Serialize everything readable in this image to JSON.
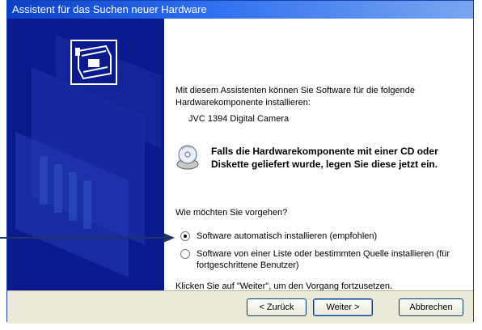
{
  "window": {
    "title": "Assistent für das Suchen neuer Hardware"
  },
  "content": {
    "intro": "Mit diesem Assistenten können Sie Software für die folgende Hardwarekomponente installieren:",
    "device_name": "JVC 1394 Digital Camera",
    "cd_hint": "Falls die Hardwarekomponente mit einer CD oder Diskette geliefert wurde, legen Sie diese jetzt ein.",
    "question": "Wie möchten Sie vorgehen?",
    "options": [
      {
        "label": "Software automatisch installieren (empfohlen)",
        "selected": true
      },
      {
        "label": "Software von einer Liste oder bestimmten Quelle installieren (für fortgeschrittene Benutzer)",
        "selected": false
      }
    ],
    "footer": "Klicken Sie auf \"Weiter\", um den Vorgang fortzusetzen."
  },
  "buttons": {
    "back": "< Zurück",
    "next": "Weiter >",
    "cancel": "Abbrechen"
  },
  "icons": {
    "hardware": "hardware-card-icon",
    "cd": "cd-icon",
    "arrow": "pointer-arrow-icon"
  },
  "colors": {
    "titlebar": "#0a3fc7",
    "side_panel": "#0a1a8c",
    "button_bar": "#ece9d8"
  }
}
